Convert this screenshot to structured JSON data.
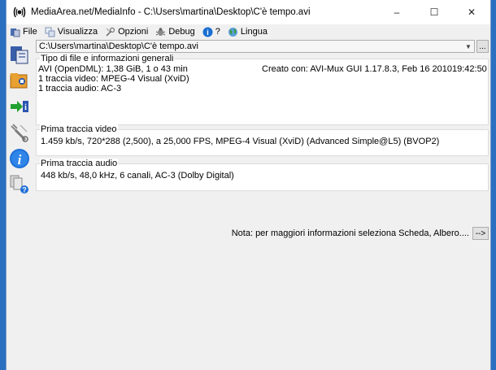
{
  "titlebar": {
    "title": "MediaArea.net/MediaInfo - C:\\Users\\martina\\Desktop\\C'è tempo.avi",
    "minimize": "–",
    "maximize": "☐",
    "close": "✕"
  },
  "menu": {
    "file": "File",
    "view": "Visualizza",
    "options": "Opzioni",
    "debug": "Debug",
    "help": "?",
    "language": "Lingua"
  },
  "path_combo": {
    "value": "C:\\Users\\martina\\Desktop\\C'è tempo.avi",
    "more_label": "..."
  },
  "general": {
    "legend": "Tipo di file e informazioni generali",
    "line1_left": "AVI (OpenDML): 1,38 GiB, 1 o 43 min",
    "line1_right": "Creato con: AVI-Mux GUI 1.17.8.3, Feb 16 201019:42:50",
    "line2": "1 traccia video: MPEG-4 Visual (XviD)",
    "line3": "1 traccia audio: AC-3"
  },
  "video": {
    "legend": "Prima traccia video",
    "line1": "1.459 kb/s, 720*288 (2,500), a 25,000 FPS, MPEG-4 Visual (XviD) (Advanced Simple@L5) (BVOP2)"
  },
  "audio": {
    "legend": "Prima traccia audio",
    "line1": "448 kb/s, 48,0 kHz, 6 canali, AC-3 (Dolby Digital)"
  },
  "note": {
    "text": "Nota: per maggiori informazioni seleziona Scheda, Albero....",
    "button": "-->"
  }
}
